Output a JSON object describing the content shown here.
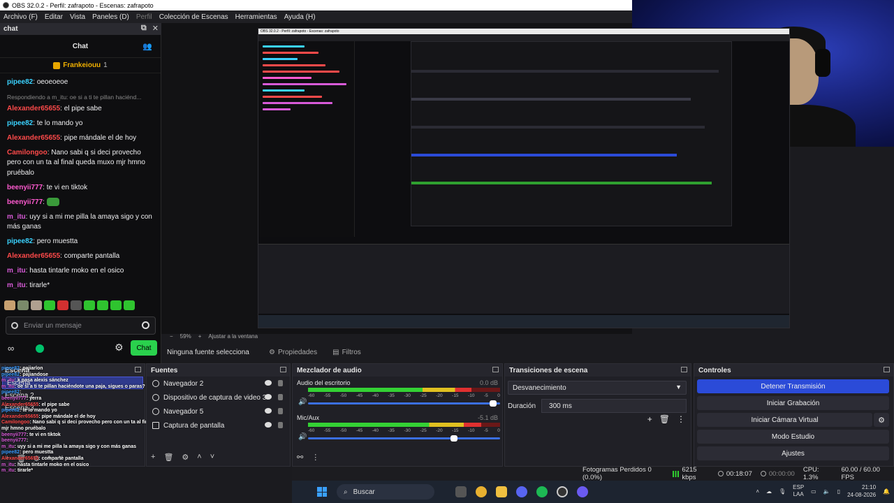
{
  "window": {
    "title": "OBS 32.0.2 - Perfil: zafrapoto - Escenas: zafrapoto"
  },
  "menu": [
    "Archivo (F)",
    "Editar",
    "Vista",
    "Paneles (D)",
    "Perfil",
    "Colección de Escenas",
    "Herramientas",
    "Ayuda (H)"
  ],
  "chat": {
    "dock_title": "chat",
    "header": "Chat",
    "pinned_user": "Frankeiouu",
    "pinned_count": "1",
    "reply_hint": "Respondiendo a m_itu: oe si a ti te pillan haciénd...",
    "messages": [
      {
        "user": "pipee82",
        "text": "oeoeoeoe",
        "color": "#3ad2ff"
      },
      {
        "user": "Alexander65655",
        "text": "el pipe sabe",
        "color": "#ff4a4a"
      },
      {
        "user": "pipee82",
        "text": "te lo mando yo",
        "color": "#3ad2ff"
      },
      {
        "user": "Alexander65655",
        "text": "pipe mándale el de hoy",
        "color": "#ff4a4a"
      },
      {
        "user": "Camilongoo",
        "text": "Nano sabi q si deci provecho pero con un ta al final queda muxo mjr hmno pruébalo",
        "color": "#ff4a4a"
      },
      {
        "user": "beenyii777",
        "text": "te vi en tiktok",
        "color": "#ff5ad0"
      },
      {
        "user": "beenyii777",
        "text": "",
        "color": "#ff5ad0"
      },
      {
        "user": "m_itu",
        "text": "uyy si a mi me pilla la amaya sigo y con más ganas",
        "color": "#d85ad8"
      },
      {
        "user": "pipee82",
        "text": "pero muestta",
        "color": "#3ad2ff"
      },
      {
        "user": "Alexander65655",
        "text": "comparte pantalla",
        "color": "#ff4a4a"
      },
      {
        "user": "m_itu",
        "text": "hasta tintarle moko en el osico",
        "color": "#d85ad8"
      },
      {
        "user": "m_itu",
        "text": "tirarle*",
        "color": "#d85ad8"
      }
    ],
    "input_placeholder": "Enviar un mensaje",
    "send_label": "Chat",
    "infinity": "∞"
  },
  "zoom": {
    "level": "59%",
    "fit": "Ajustar a la ventana"
  },
  "source_bar": {
    "label": "Ninguna fuente selecciona",
    "props": "Propiedades",
    "filters": "Filtros"
  },
  "scenes": {
    "title": "Escena",
    "items": [
      "Escena",
      "Escena 2",
      "Escena 3"
    ]
  },
  "sources": {
    "title": "Fuentes",
    "items": [
      "Navegador 2",
      "Dispositivo de captura de video 3",
      "Navegador 5",
      "Captura de pantalla"
    ]
  },
  "mixer": {
    "title": "Mezclador de audio",
    "channels": [
      {
        "name": "Audio del escritorio",
        "db": "0.0 dB",
        "level": 0.85,
        "volume": 0.98
      },
      {
        "name": "Mic/Aux",
        "db": "-5.1 dB",
        "level": 0.9,
        "volume": 0.78
      }
    ],
    "scale": [
      "-60",
      "-55",
      "-50",
      "-45",
      "-40",
      "-35",
      "-30",
      "-25",
      "-20",
      "-15",
      "-10",
      "-5",
      "0"
    ]
  },
  "transitions": {
    "title": "Transiciones de escena",
    "selected": "Desvanecimiento",
    "duration_label": "Duración",
    "duration_value": "300 ms"
  },
  "controls": {
    "title": "Controles",
    "stop_stream": "Detener Transmisión",
    "start_rec": "Iniciar Grabación",
    "start_vcam": "Iniciar Cámara Virtual",
    "studio": "Modo Estudio",
    "settings": "Ajustes"
  },
  "status": {
    "frames_lost": "Fotogramas Perdidos 0 (0.0%)",
    "kbps": "6215 kbps",
    "stream_time": "00:18:07",
    "rec_time": "00:00:00",
    "cpu": "CPU: 1.3%",
    "fps": "60.00 / 60.00 FPS"
  },
  "taskbar": {
    "search": "Buscar",
    "lang_1": "ESP",
    "lang_2": "LAA",
    "time": "21:10",
    "date": "24-08-2026"
  },
  "overlay_chat": [
    {
      "user": "pipee82",
      "text": "pajiarlon"
    },
    {
      "user": "pipee82",
      "text": "pajiandose"
    },
    {
      "user": "m_itu",
      "text": "k pasa alexis sánchez"
    },
    {
      "user": "m_itu",
      "text": "oe si a ti te pillan haciéndote una paja, sigues o paras?"
    },
    {
      "user": "pipee82",
      "text": ""
    },
    {
      "user": "beenyii777",
      "text": "yerra"
    },
    {
      "user": "Alexander65655",
      "text": "el pipe sabe"
    },
    {
      "user": "pipee82",
      "text": "te lo mando yo"
    },
    {
      "user": "Alexander65655",
      "text": "pipe mándale el de hoy"
    },
    {
      "user": "Camilongoo",
      "text": "Nano sabi q si deci provecho pero con un ta al final queda muxo"
    },
    {
      "user": "",
      "text": "mjr hmno pruébalo"
    },
    {
      "user": "beenyii777",
      "text": "te vi en tiktok"
    },
    {
      "user": "beenyii777",
      "text": ""
    },
    {
      "user": "m_itu",
      "text": "uyy si a mi me pilla la amaya sigo y con más ganas"
    },
    {
      "user": "pipee82",
      "text": "pero muestta"
    },
    {
      "user": "Alexander65655",
      "text": "comparte pantalla"
    },
    {
      "user": "m_itu",
      "text": "hasta tintarle moko en el osico"
    },
    {
      "user": "m_itu",
      "text": "tirarle*"
    }
  ]
}
